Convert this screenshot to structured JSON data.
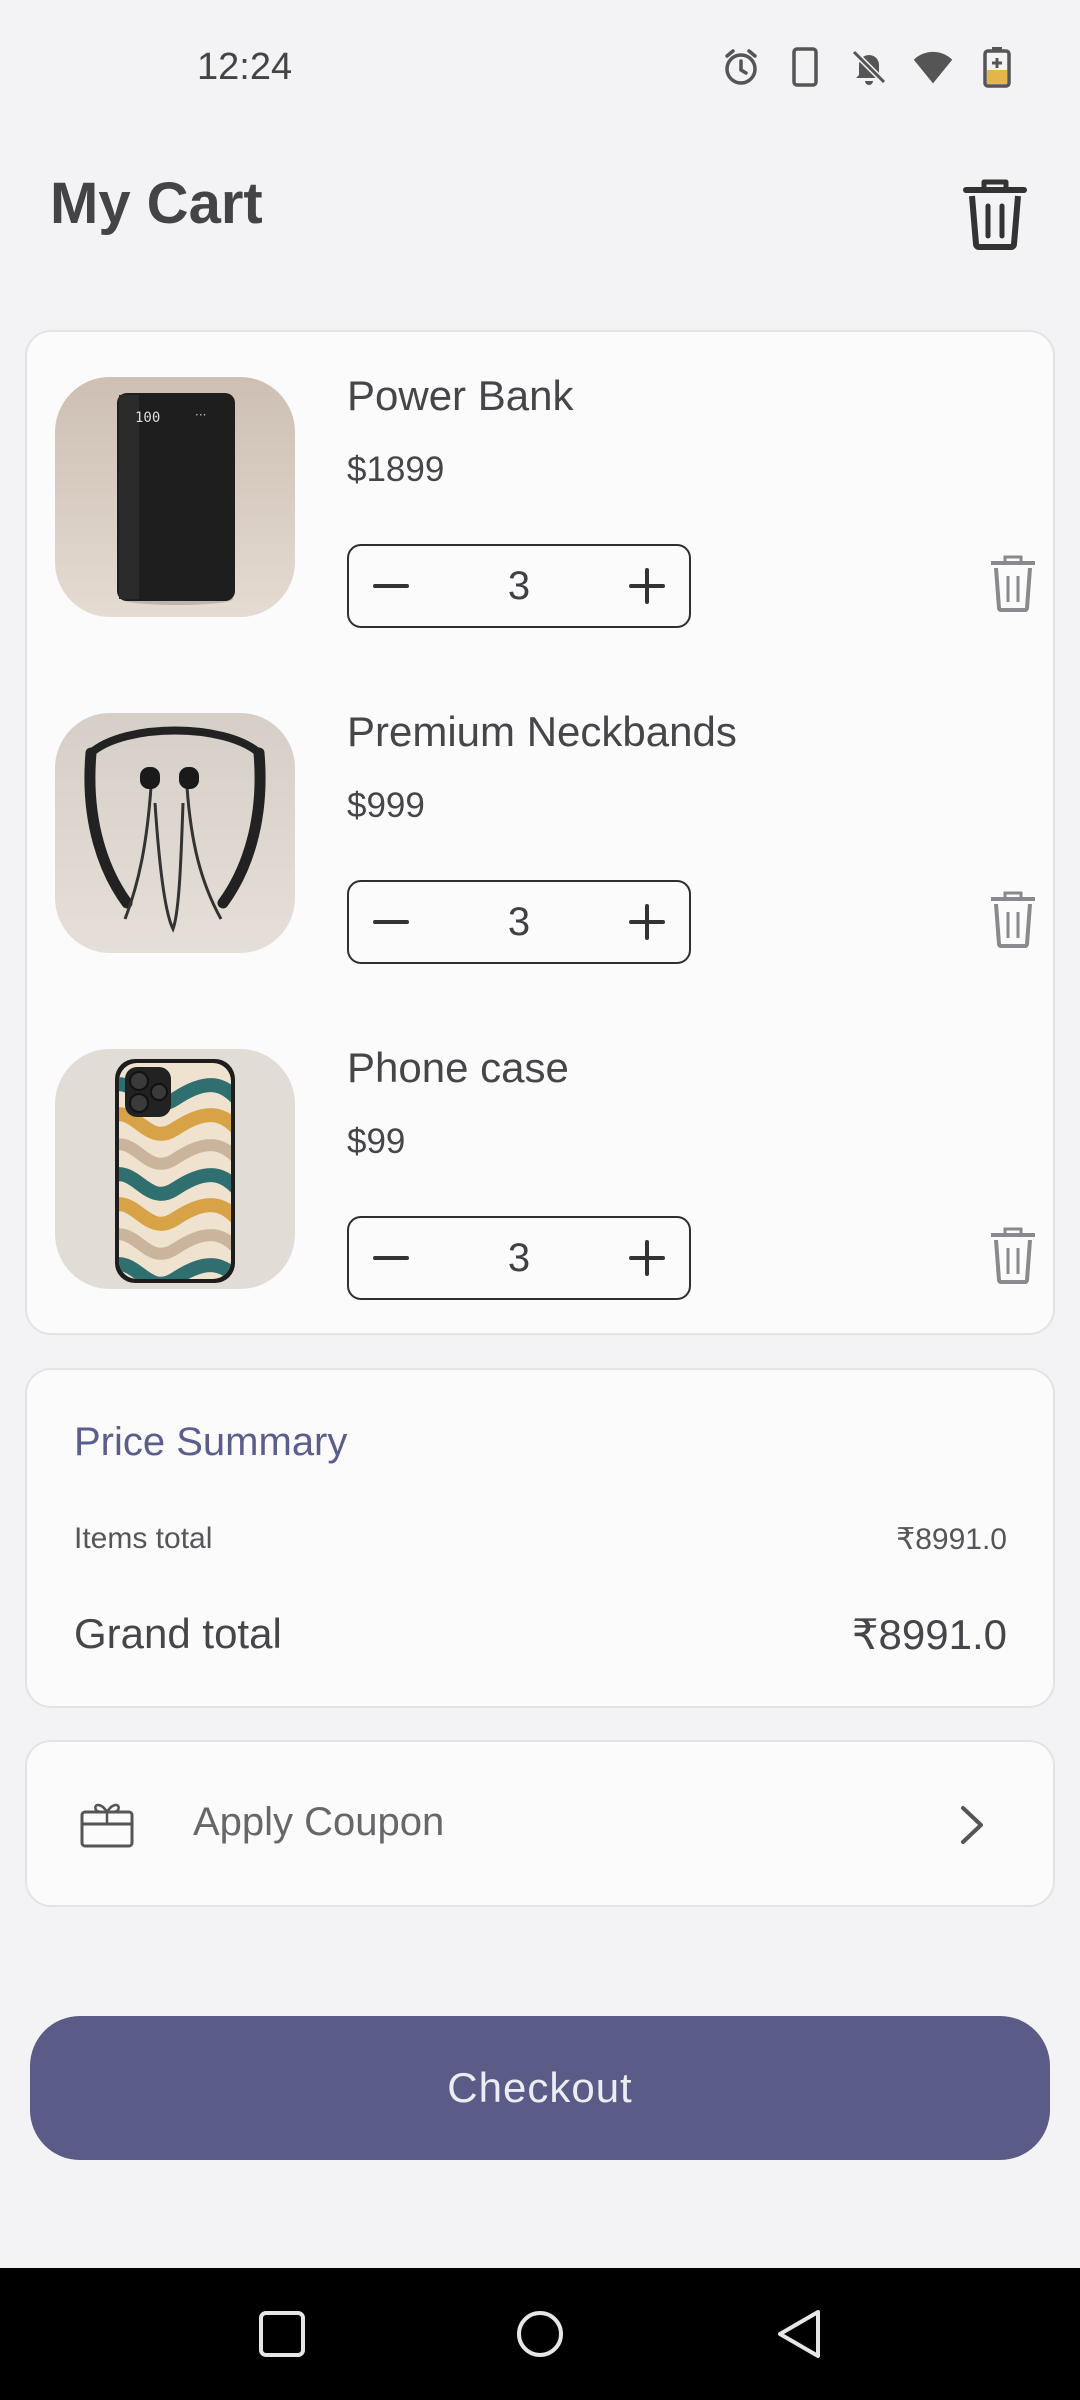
{
  "status_bar": {
    "time": "12:24",
    "icons": [
      "alarm-icon",
      "phone-icon",
      "bell-off-icon",
      "wifi-icon",
      "battery-charging-icon"
    ]
  },
  "header": {
    "title": "My Cart",
    "trash_icon": "trash-icon"
  },
  "cart": {
    "items": [
      {
        "name": "Power Bank",
        "price": "$1899",
        "quantity": "3"
      },
      {
        "name": "Premium Neckbands",
        "price": "$999",
        "quantity": "3"
      },
      {
        "name": "Phone case",
        "price": "$99",
        "quantity": "3"
      }
    ]
  },
  "summary": {
    "title": "Price Summary",
    "items_total_label": "Items total",
    "items_total_value": "₹8991.0",
    "grand_total_label": "Grand total",
    "grand_total_value": "₹8991.0"
  },
  "coupon": {
    "label": "Apply Coupon",
    "icon": "gift-card-icon"
  },
  "checkout": {
    "label": "Checkout"
  },
  "colors": {
    "accent": "#5a5b87",
    "summary_title": "#5b5e8c",
    "background": "#f3f2f4",
    "card": "#fbfbfb"
  },
  "nav": {
    "icons": [
      "recents-icon",
      "home-icon",
      "back-icon"
    ]
  }
}
